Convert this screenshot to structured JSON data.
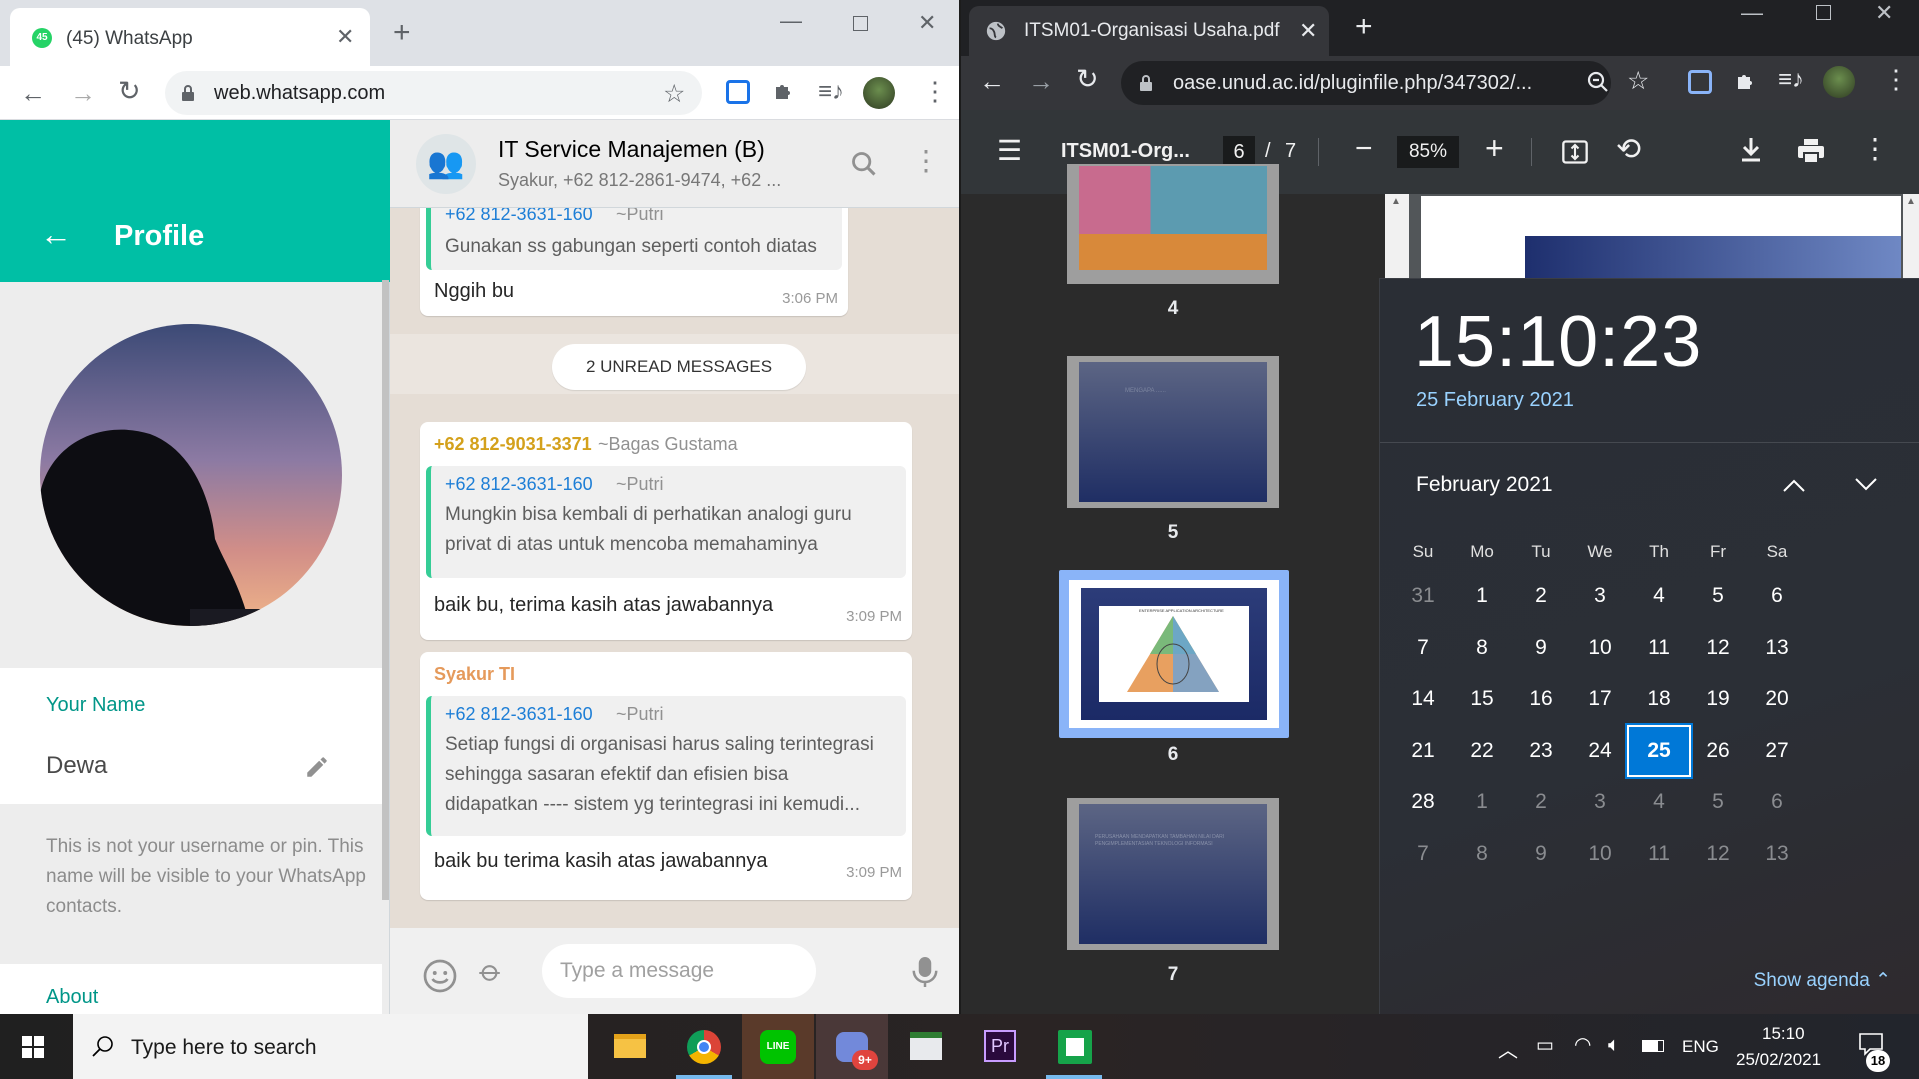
{
  "left_browser": {
    "tab_title": "(45) WhatsApp",
    "tab_badge": "45",
    "url": "web.whatsapp.com"
  },
  "profile": {
    "title": "Profile",
    "name_label": "Your Name",
    "name_value": "Dewa",
    "hint": "This is not your username or pin. This name will be visible to your WhatsApp contacts.",
    "about_label": "About"
  },
  "chat": {
    "group_name": "IT Service Manajemen (B)",
    "members": "Syakur, +62 812-2861-9474, +62 ...",
    "msg0_quote_name": "+62 812-3631-160",
    "msg0_quote_push": "~Putri",
    "msg0_quote_text": "Gunakan ss gabungan seperti contoh diatas",
    "msg0_text": "Nggih bu",
    "msg0_time": "3:06 PM",
    "unread": "2 UNREAD MESSAGES",
    "msg1_sender": "+62 812-9031-3371",
    "msg1_sender_push": "~Bagas Gustama",
    "msg1_quote_name": "+62 812-3631-160",
    "msg1_quote_push": "~Putri",
    "msg1_quote_line1": "Mungkin bisa kembali di perhatikan analogi guru",
    "msg1_quote_line2": "privat di atas untuk mencoba memahaminya",
    "msg1_text": "baik bu, terima kasih atas jawabannya",
    "msg1_time": "3:09 PM",
    "msg2_sender": "Syakur TI",
    "msg2_quote_name": "+62 812-3631-160",
    "msg2_quote_push": "~Putri",
    "msg2_quote_line1": "Setiap fungsi di organisasi harus saling terintegrasi",
    "msg2_quote_line2": "sehingga sasaran efektif dan efisien bisa",
    "msg2_quote_line3": "didapatkan ---- sistem yg terintegrasi ini kemudi...",
    "msg2_text": "baik bu terima kasih atas jawabannya",
    "msg2_time": "3:09 PM",
    "composer_placeholder": "Type a message"
  },
  "right_browser": {
    "tab_title": "ITSM01-Organisasi Usaha.pdf",
    "url": "oase.unud.ac.id/pluginfile.php/347302/...",
    "pdf_title": "ITSM01-Org...",
    "page_current": "6",
    "page_sep": "/",
    "page_total": "7",
    "zoom": "85%",
    "thumbs": [
      "4",
      "5",
      "6",
      "7"
    ],
    "thumb5_text": "MENGAPA ......",
    "thumb7_text": "PERUSAHAAN MENDAPATKAN TAMBAHAN NILAI DARI PENGIMPLEMENTASIAN TEKNOLOGI INFORMASI",
    "thumb6_text": "ENTERPRISE APPLICATION ARCHITECTURE"
  },
  "calendar": {
    "time": "15:10:23",
    "date_long": "25 February 2021",
    "month_title": "February 2021",
    "weekdays": [
      "Su",
      "Mo",
      "Tu",
      "We",
      "Th",
      "Fr",
      "Sa"
    ],
    "rows": [
      [
        "31",
        "1",
        "2",
        "3",
        "4",
        "5",
        "6"
      ],
      [
        "7",
        "8",
        "9",
        "10",
        "11",
        "12",
        "13"
      ],
      [
        "14",
        "15",
        "16",
        "17",
        "18",
        "19",
        "20"
      ],
      [
        "21",
        "22",
        "23",
        "24",
        "25",
        "26",
        "27"
      ],
      [
        "28",
        "1",
        "2",
        "3",
        "4",
        "5",
        "6"
      ],
      [
        "7",
        "8",
        "9",
        "10",
        "11",
        "12",
        "13"
      ]
    ],
    "today": "25",
    "show_agenda": "Show agenda"
  },
  "taskbar": {
    "search_placeholder": "Type here to search",
    "language": "ENG",
    "time": "15:10",
    "date": "25/02/2021",
    "notifications": "18",
    "discord_badge": "9+"
  },
  "colors": {
    "whatsapp_teal": "#00bfa5",
    "windows_accent": "#0078d7",
    "link_blue": "#99d2ff"
  }
}
